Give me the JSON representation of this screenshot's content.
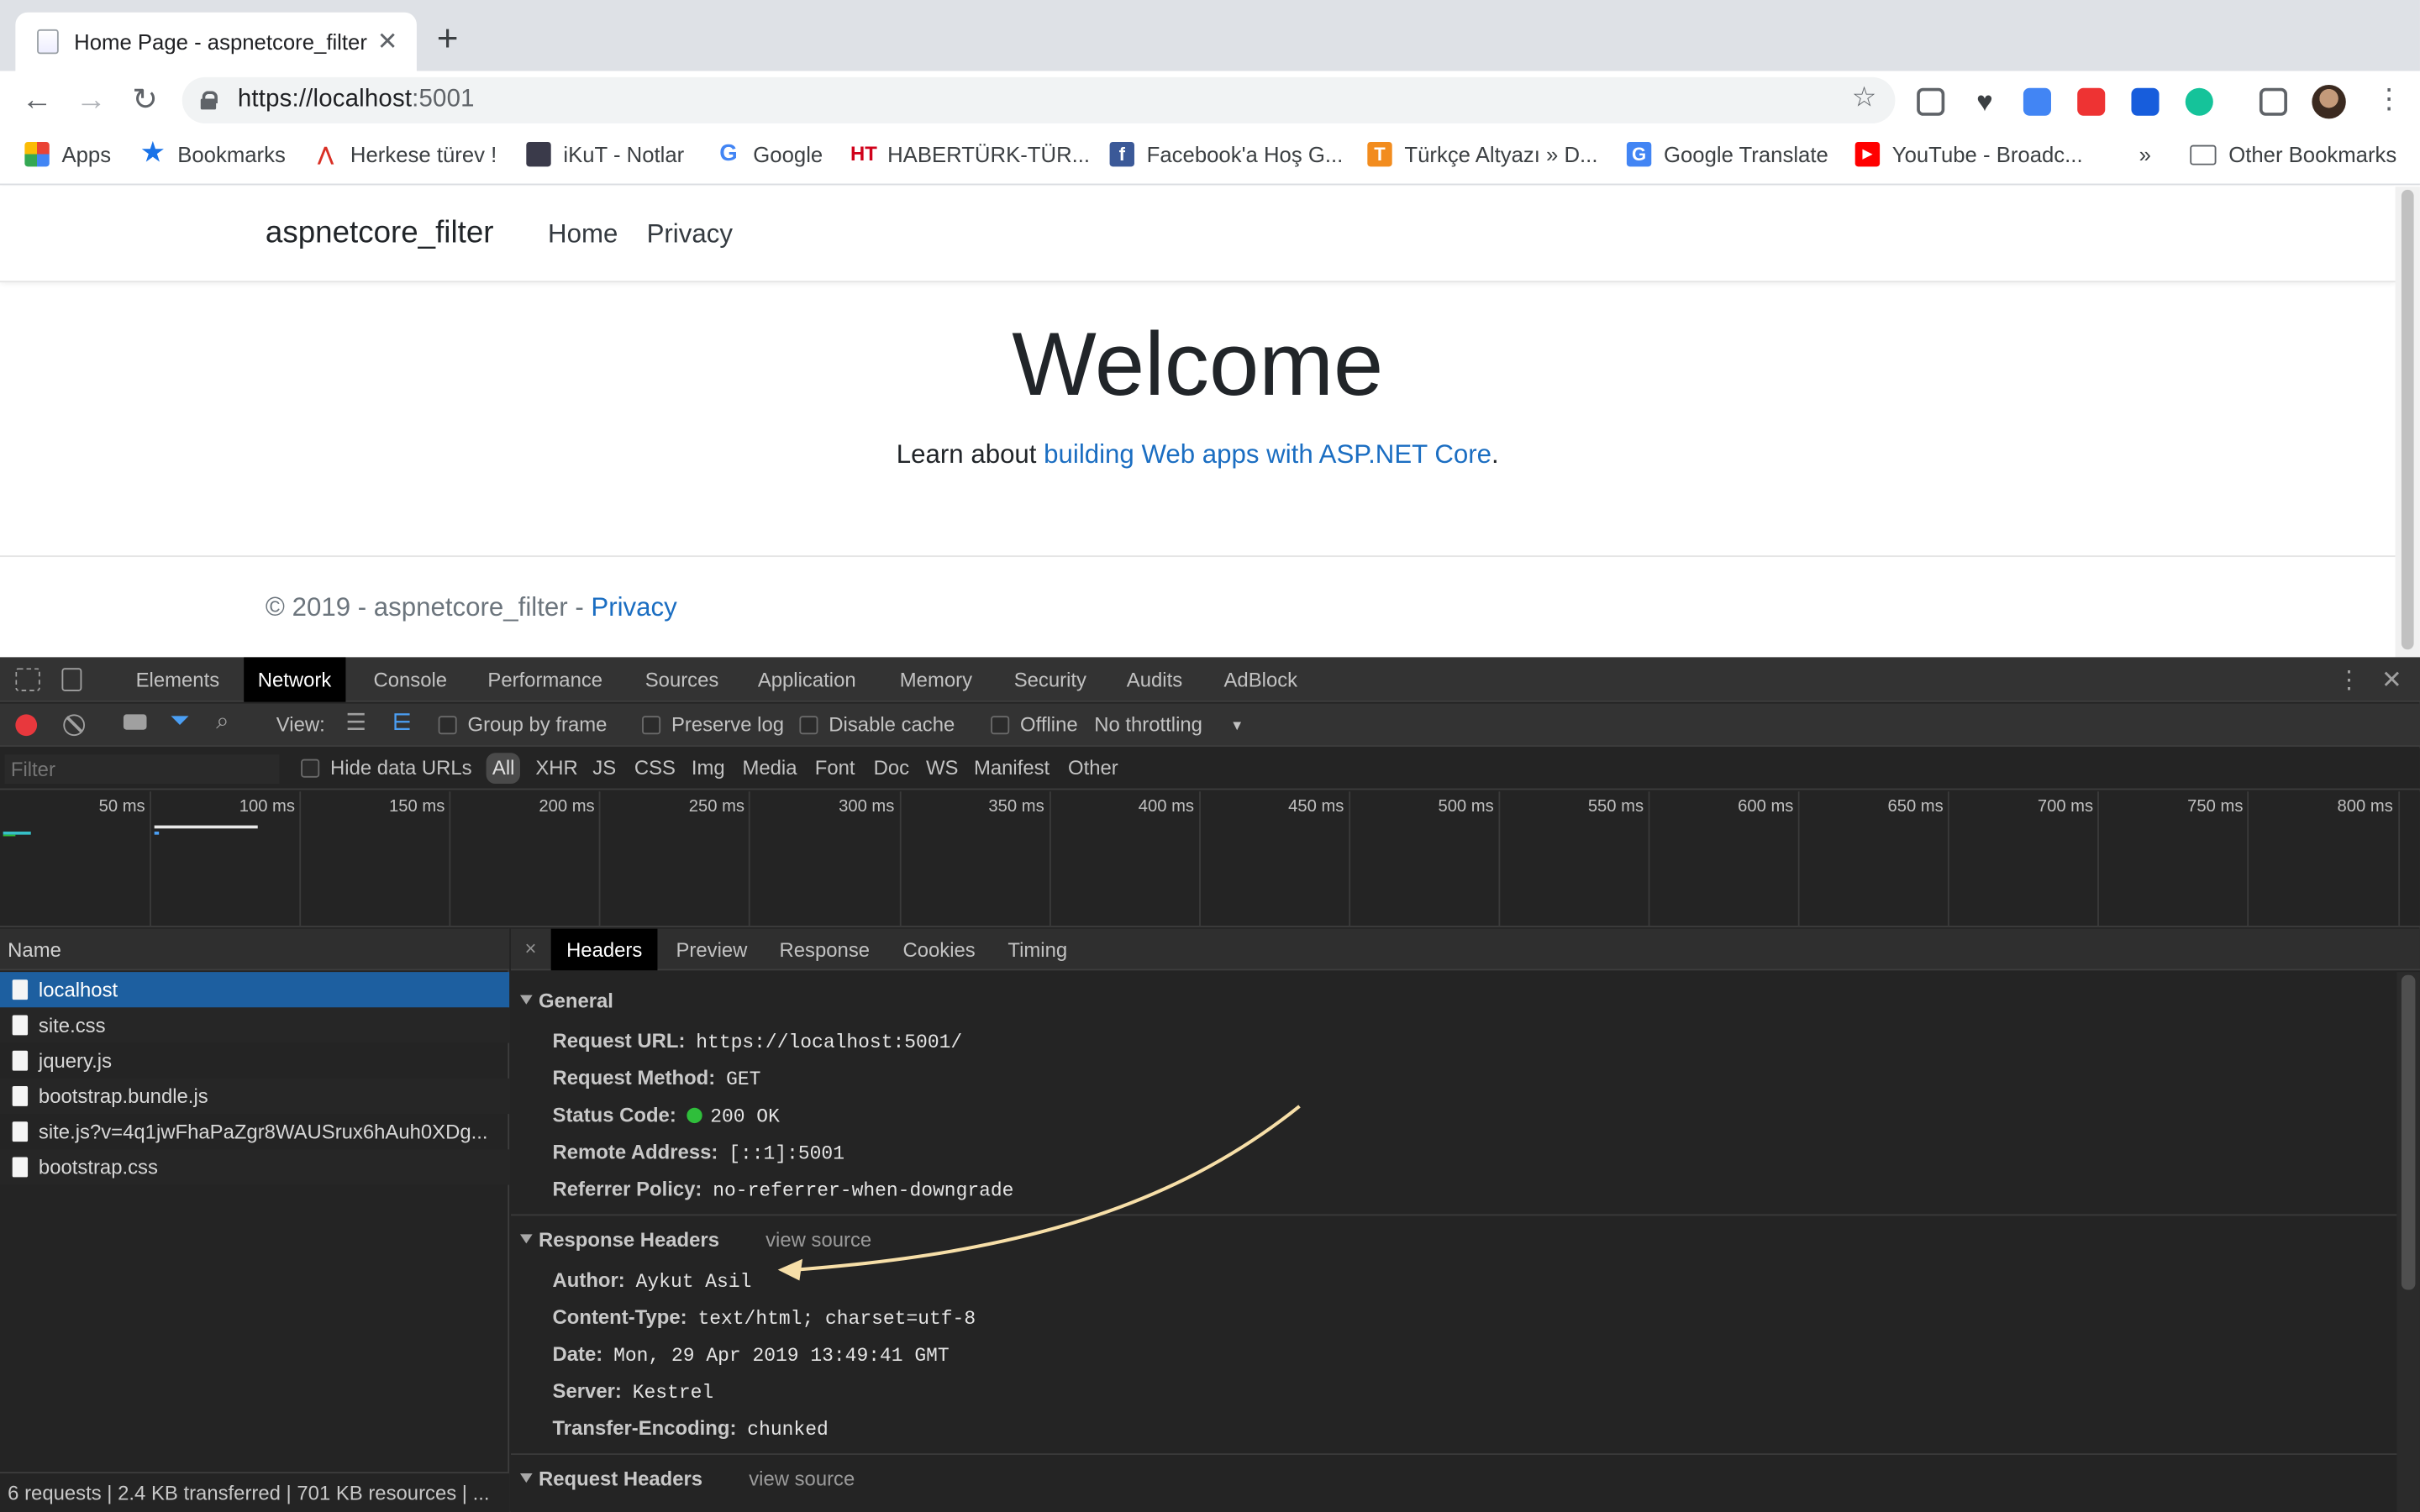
{
  "browser": {
    "tab_title": "Home Page - aspnetcore_filter",
    "tab_close": "✕",
    "new_tab": "+",
    "url_host": "https://localhost",
    "url_port": ":5001",
    "nav": {
      "back": "←",
      "forward": "→",
      "reload": "↻"
    },
    "star": "☆",
    "menu": "⋮",
    "extensions": [
      {
        "name": "pocket-icon",
        "color": "#5f6368"
      },
      {
        "name": "heart-icon",
        "color": "#3c4043"
      },
      {
        "name": "google-translate-icon",
        "color": "#4285f4"
      },
      {
        "name": "adblock-icon",
        "color": "#e33"
      },
      {
        "name": "bitwarden-icon",
        "color": "#175ddc"
      },
      {
        "name": "grammarly-icon",
        "color": "#15c39a"
      },
      {
        "name": "cast-icon",
        "color": "#5f6368"
      }
    ]
  },
  "bookmarks": {
    "items": [
      "Apps",
      "Bookmarks",
      "Herkese türev !",
      "iKuT - Notlar",
      "Google",
      "HABERTÜRK-TÜR...",
      "Facebook'a Hoş G...",
      "Türkçe Altyazı » D...",
      "Google Translate",
      "YouTube - Broadc..."
    ],
    "overflow": "»",
    "other": "Other Bookmarks"
  },
  "site": {
    "brand": "aspnetcore_filter",
    "nav": [
      "Home",
      "Privacy"
    ],
    "welcome": "Welcome",
    "learn_prefix": "Learn about ",
    "learn_link": "building Web apps with ASP.NET Core",
    "learn_suffix": ".",
    "footer_text": "© 2019 - aspnetcore_filter - ",
    "footer_link": "Privacy"
  },
  "devtools": {
    "tabs": [
      "Elements",
      "Network",
      "Console",
      "Performance",
      "Sources",
      "Application",
      "Memory",
      "Security",
      "Audits",
      "AdBlock"
    ],
    "active_tab": "Network",
    "more": "⋮",
    "close": "✕",
    "toolbar": {
      "view_label": "View:",
      "group_by_frame": "Group by frame",
      "preserve_log": "Preserve log",
      "disable_cache": "Disable cache",
      "offline": "Offline",
      "throttling": "No throttling",
      "throttling_caret": "▼"
    },
    "filter": {
      "placeholder": "Filter",
      "hide_data_urls": "Hide data URLs",
      "types": [
        "All",
        "XHR",
        "JS",
        "CSS",
        "Img",
        "Media",
        "Font",
        "Doc",
        "WS",
        "Manifest",
        "Other"
      ],
      "active_type": "All"
    },
    "timeline_ticks": [
      "50 ms",
      "100 ms",
      "150 ms",
      "200 ms",
      "250 ms",
      "300 ms",
      "350 ms",
      "400 ms",
      "450 ms",
      "500 ms",
      "550 ms",
      "600 ms",
      "650 ms",
      "700 ms",
      "750 ms",
      "800 ms"
    ],
    "requests": {
      "header": "Name",
      "rows": [
        "localhost",
        "site.css",
        "jquery.js",
        "bootstrap.bundle.js",
        "site.js?v=4q1jwFhaPaZgr8WAUSrux6hAuh0XDg...",
        "bootstrap.css"
      ],
      "selected": "localhost",
      "status": "6 requests | 2.4 KB transferred | 701 KB resources | ..."
    },
    "details": {
      "close": "×",
      "tabs": [
        "Headers",
        "Preview",
        "Response",
        "Cookies",
        "Timing"
      ],
      "active_tab": "Headers",
      "general": {
        "title": "General",
        "rows": [
          {
            "k": "Request URL:",
            "v": "https://localhost:5001/"
          },
          {
            "k": "Request Method:",
            "v": "GET"
          },
          {
            "k": "Status Code:",
            "v": "200 OK"
          },
          {
            "k": "Remote Address:",
            "v": "[::1]:5001"
          },
          {
            "k": "Referrer Policy:",
            "v": "no-referrer-when-downgrade"
          }
        ]
      },
      "response_headers": {
        "title": "Response Headers",
        "view_source": "view source",
        "rows": [
          {
            "k": "Author:",
            "v": "Aykut Asil"
          },
          {
            "k": "Content-Type:",
            "v": "text/html; charset=utf-8"
          },
          {
            "k": "Date:",
            "v": "Mon, 29 Apr 2019 13:49:41 GMT"
          },
          {
            "k": "Server:",
            "v": "Kestrel"
          },
          {
            "k": "Transfer-Encoding:",
            "v": "chunked"
          }
        ]
      },
      "request_headers": {
        "title": "Request Headers",
        "view_source": "view source"
      },
      "annotation_color": "#f7dfa8"
    }
  }
}
